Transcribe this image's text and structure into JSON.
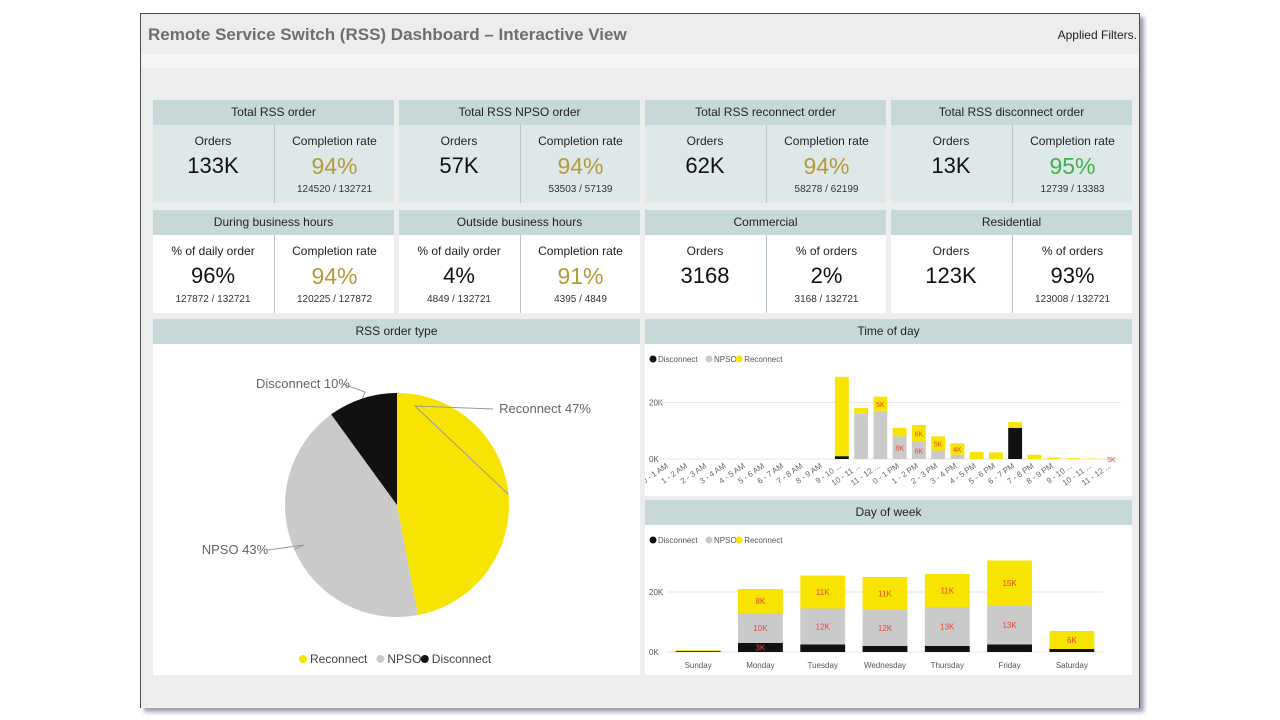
{
  "header": {
    "title": "Remote Service Switch (RSS) Dashboard – Interactive View",
    "filters_label": "Applied Filters."
  },
  "kpis_top": [
    {
      "title": "Total RSS order",
      "left_label": "Orders",
      "left_value": "133K",
      "right_label": "Completion rate",
      "right_value": "94%",
      "right_sub": "124520 / 132721",
      "accent": "#b49a3a"
    },
    {
      "title": "Total RSS NPSO order",
      "left_label": "Orders",
      "left_value": "57K",
      "right_label": "Completion rate",
      "right_value": "94%",
      "right_sub": "53503 / 57139",
      "accent": "#b49a3a"
    },
    {
      "title": "Total RSS reconnect order",
      "left_label": "Orders",
      "left_value": "62K",
      "right_label": "Completion rate",
      "right_value": "94%",
      "right_sub": "58278 / 62199",
      "accent": "#b49a3a"
    },
    {
      "title": "Total RSS disconnect order",
      "left_label": "Orders",
      "left_value": "13K",
      "right_label": "Completion rate",
      "right_value": "95%",
      "right_sub": "12739 / 13383",
      "accent": "#3fb24b"
    }
  ],
  "kpis_bottom": [
    {
      "title": "During business hours",
      "left_label": "% of daily order",
      "left_value": "96%",
      "left_sub": "127872 / 132721",
      "right_label": "Completion rate",
      "right_value": "94%",
      "right_sub": "120225 / 127872"
    },
    {
      "title": "Outside business hours",
      "left_label": "% of daily order",
      "left_value": "4%",
      "left_sub": "4849 / 132721",
      "right_label": "Completion rate",
      "right_value": "91%",
      "right_sub": "4395 / 4849"
    },
    {
      "title": "Commercial",
      "left_label": "Orders",
      "left_value": "3168",
      "right_label": "% of orders",
      "right_value": "2%",
      "right_sub": "3168 / 132721"
    },
    {
      "title": "Residential",
      "left_label": "Orders",
      "left_value": "123K",
      "right_label": "% of orders",
      "right_value": "93%",
      "right_sub": "123008 / 132721"
    }
  ],
  "panels": {
    "order_type": "RSS order type",
    "time_of_day": "Time of day",
    "day_of_week": "Day of week"
  },
  "colors": {
    "reconnect": "#f7e400",
    "npso": "#cacaca",
    "disconnect": "#111111",
    "header_bg": "#c7d8d9",
    "gold": "#b49a3a",
    "green": "#3fb24b"
  },
  "chart_data": [
    {
      "type": "pie",
      "title": "RSS order type",
      "slices": [
        {
          "name": "Reconnect",
          "value": 47,
          "label": "Reconnect 47%"
        },
        {
          "name": "NPSO",
          "value": 43,
          "label": "NPSO 43%"
        },
        {
          "name": "Disconnect",
          "value": 10,
          "label": "Disconnect 10%"
        }
      ],
      "legend": [
        "Reconnect",
        "NPSO",
        "Disconnect"
      ],
      "legend_position": "bottom"
    },
    {
      "type": "bar",
      "stacked": true,
      "title": "Time of day",
      "legend": [
        "Disconnect",
        "NPSO",
        "Reconnect"
      ],
      "legend_position": "top-left",
      "yticks": [
        "20K",
        "0K"
      ],
      "ylim": [
        0,
        30000
      ],
      "categories": [
        "0 - 1 AM",
        "1 - 2 AM",
        "2 - 3 AM",
        "3 - 4 AM",
        "4 - 5 AM",
        "5 - 6 AM",
        "6 - 7 AM",
        "7 - 8 AM",
        "8 - 9 AM",
        "9 - 10 ...",
        "10 - 11 ...",
        "11 - 12 ...",
        "0 - 1 PM",
        "1 - 2 PM",
        "2 - 3 PM",
        "3 - 4 PM",
        "4 - 5 PM",
        "5 - 6 PM",
        "6 - 7 PM",
        "7 - 8 PM",
        "8 - 9 PM",
        "9 - 10 ...",
        "10 - 11 ...",
        "11 - 12 ..."
      ],
      "series": [
        {
          "name": "Disconnect",
          "values": [
            0,
            0,
            0,
            0,
            0,
            0,
            0,
            0,
            0,
            1000,
            0,
            0,
            0,
            0,
            0,
            0,
            0,
            0,
            11000,
            0,
            0,
            0,
            0,
            0
          ]
        },
        {
          "name": "NPSO",
          "values": [
            0,
            0,
            0,
            0,
            0,
            0,
            0,
            0,
            0,
            0,
            16000,
            17000,
            8000,
            6000,
            3000,
            1500,
            0,
            0,
            0,
            0,
            0,
            0,
            0,
            0
          ]
        },
        {
          "name": "Reconnect",
          "values": [
            0,
            0,
            0,
            0,
            0,
            0,
            0,
            0,
            0,
            28000,
            2000,
            5000,
            3000,
            6000,
            5000,
            4000,
            2500,
            2300,
            2000,
            1500,
            500,
            300,
            150,
            50
          ]
        }
      ],
      "data_labels": {
        "11 - 12 ...": {
          "Reconnect": "5K"
        },
        "0 - 1 PM": {
          "NPSO": "8K"
        },
        "1 - 2 PM": {
          "Reconnect": "6K",
          "NPSO": "6K"
        },
        "2 - 3 PM": {
          "Reconnect": "5K"
        },
        "3 - 4 PM": {
          "Reconnect": "4K"
        }
      }
    },
    {
      "type": "bar",
      "stacked": true,
      "title": "Day of week",
      "legend": [
        "Disconnect",
        "NPSO",
        "Reconnect"
      ],
      "legend_position": "top-left",
      "yticks": [
        "20K",
        "0K"
      ],
      "ylim": [
        0,
        30000
      ],
      "categories": [
        "Sunday",
        "Monday",
        "Tuesday",
        "Wednesday",
        "Thursday",
        "Friday",
        "Saturday"
      ],
      "series": [
        {
          "name": "Disconnect",
          "values": [
            300,
            3000,
            2500,
            2000,
            2000,
            2500,
            1000
          ]
        },
        {
          "name": "NPSO",
          "values": [
            0,
            10000,
            12000,
            12000,
            13000,
            13000,
            0
          ]
        },
        {
          "name": "Reconnect",
          "values": [
            300,
            8000,
            11000,
            11000,
            11000,
            15000,
            6000
          ]
        }
      ],
      "data_labels": {
        "Monday": {
          "Disconnect": "3K",
          "NPSO": "10K",
          "Reconnect": "8K"
        },
        "Tuesday": {
          "NPSO": "12K",
          "Reconnect": "11K"
        },
        "Wednesday": {
          "NPSO": "12K",
          "Reconnect": "11K"
        },
        "Thursday": {
          "NPSO": "13K",
          "Reconnect": "11K"
        },
        "Friday": {
          "NPSO": "13K",
          "Reconnect": "15K"
        },
        "Saturday": {
          "Reconnect": "6K"
        }
      }
    }
  ]
}
